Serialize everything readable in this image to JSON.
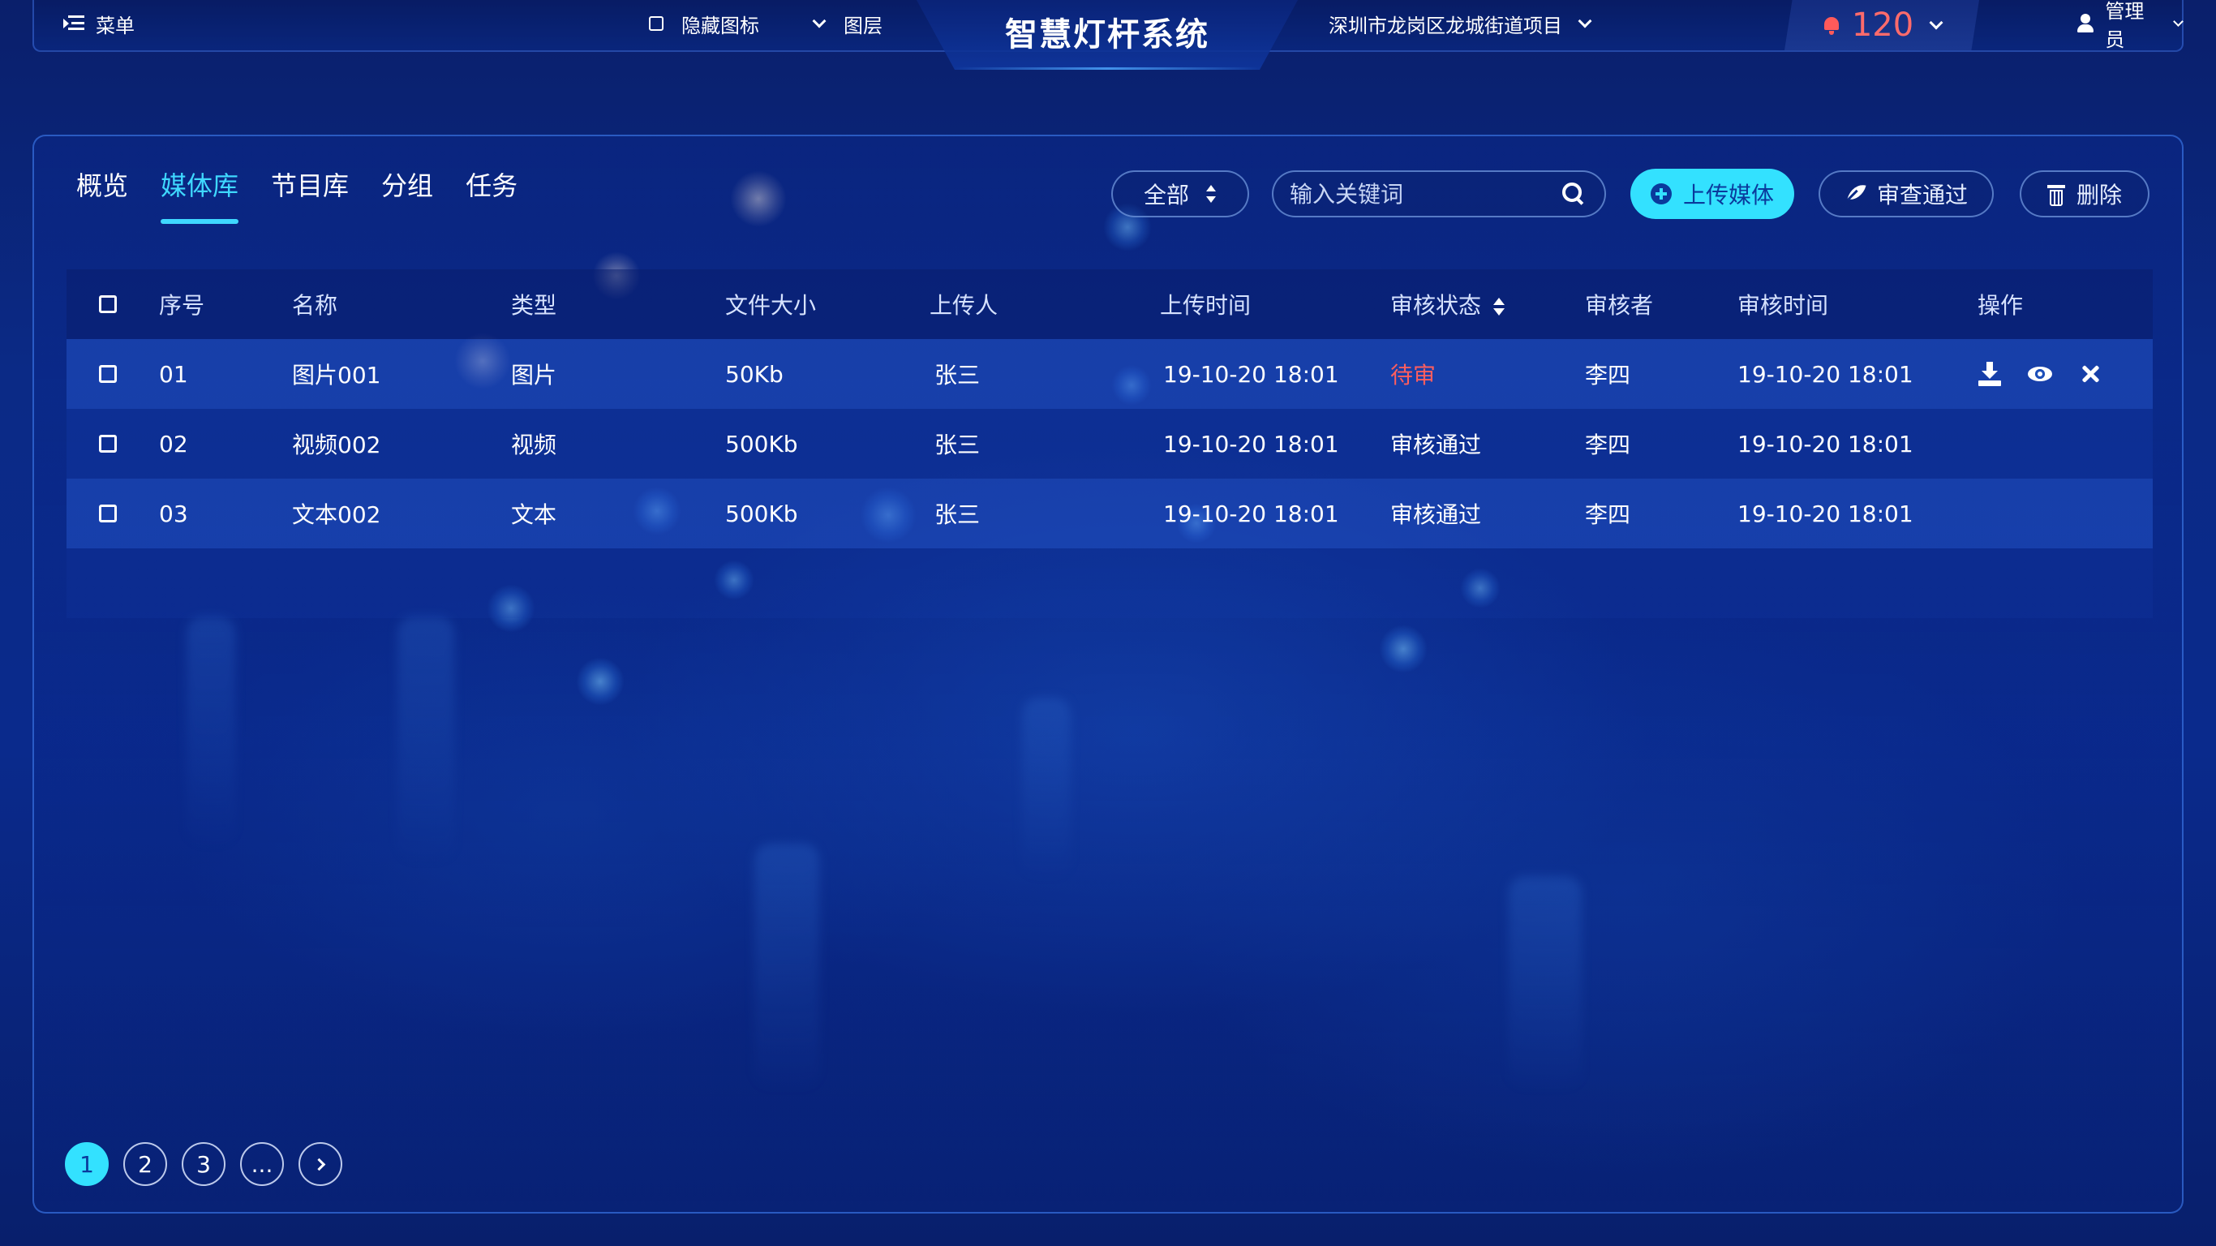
{
  "topbar": {
    "menu_label": "菜单",
    "hide_icons_label": "隐藏图标",
    "layers_label": "图层",
    "app_title": "智慧灯杆系统",
    "project_label": "深圳市龙岗区龙城街道项目",
    "alert_count": "120",
    "user_label": "管理员"
  },
  "tabs": [
    {
      "label": "概览",
      "active": false
    },
    {
      "label": "媒体库",
      "active": true
    },
    {
      "label": "节目库",
      "active": false
    },
    {
      "label": "分组",
      "active": false
    },
    {
      "label": "任务",
      "active": false
    }
  ],
  "toolbar": {
    "filter_value": "全部",
    "search_placeholder": "输入关键词",
    "upload_label": "上传媒体",
    "approve_label": "审查通过",
    "delete_label": "删除"
  },
  "table": {
    "headers": {
      "no": "序号",
      "name": "名称",
      "type": "类型",
      "size": "文件大小",
      "uploader": "上传人",
      "upload_time": "上传时间",
      "status": "审核状态",
      "reviewer": "审核者",
      "review_time": "审核时间",
      "ops": "操作"
    },
    "rows": [
      {
        "no": "01",
        "name": "图片001",
        "type": "图片",
        "size": "50Kb",
        "uploader": "张三",
        "upload_time": "19-10-20 18:01",
        "status": "待审",
        "reviewer": "李四",
        "review_time": "19-10-20 18:01"
      },
      {
        "no": "02",
        "name": "视频002",
        "type": "视频",
        "size": "500Kb",
        "uploader": "张三",
        "upload_time": "19-10-20 18:01",
        "status": "审核通过",
        "reviewer": "李四",
        "review_time": "19-10-20 18:01"
      },
      {
        "no": "03",
        "name": "文本002",
        "type": "文本",
        "size": "500Kb",
        "uploader": "张三",
        "upload_time": "19-10-20 18:01",
        "status": "审核通过",
        "reviewer": "李四",
        "review_time": "19-10-20 18:01"
      }
    ]
  },
  "pagination": {
    "pages": [
      "1",
      "2",
      "3",
      "..."
    ],
    "current": "1"
  },
  "colors": {
    "accent": "#33e1ff",
    "pending": "#ff5e5e",
    "alert": "#ff6b6b",
    "background": "#0b2a86"
  }
}
